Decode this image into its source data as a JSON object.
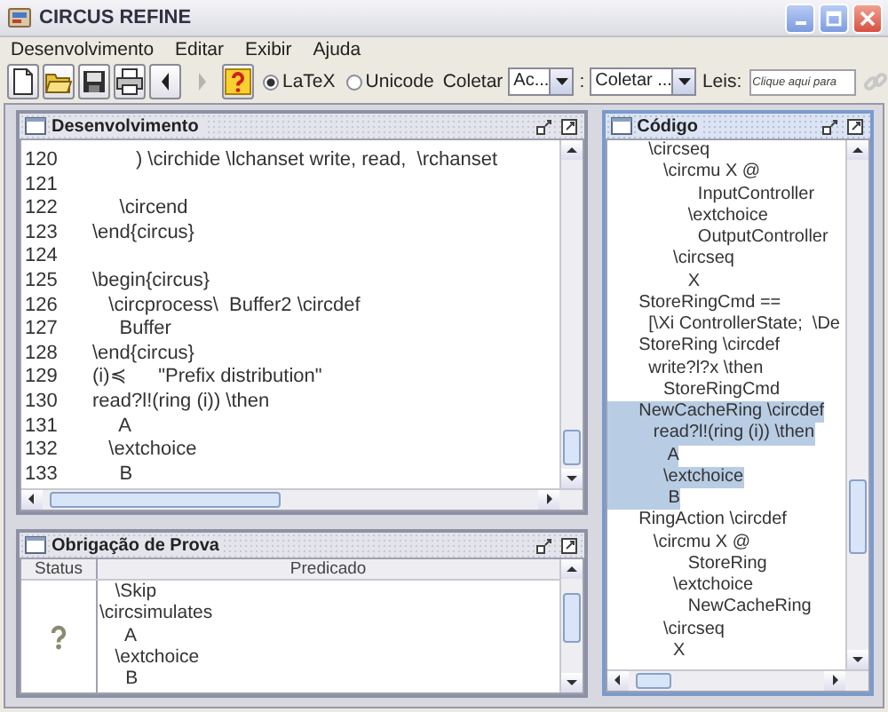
{
  "window": {
    "title": "CIRCUS REFINE"
  },
  "menu": [
    {
      "label": "Desenvolvimento"
    },
    {
      "label": "Editar"
    },
    {
      "label": "Exibir"
    },
    {
      "label": "Ajuda"
    }
  ],
  "toolbar": {
    "buttons": [
      {
        "disabled": false
      },
      {
        "disabled": false
      },
      {
        "disabled": false
      },
      {
        "disabled": false
      },
      {
        "disabled": false
      },
      {
        "disabled": true
      },
      {
        "disabled": false
      }
    ],
    "format_options": [
      {
        "label": "LaTeX",
        "selected": true
      },
      {
        "label": "Unicode",
        "selected": false
      }
    ],
    "collect_label": "Coletar",
    "collect_combo": {
      "value": "Ac..."
    },
    "separator": ":",
    "collect_combo_2": {
      "value": "Coletar ..."
    },
    "laws_label": "Leis:",
    "laws_field": {
      "placeholder": "Clique aqui para"
    },
    "link_button": {
      "disabled": true
    }
  },
  "development_panel": {
    "title": "Desenvolvimento",
    "active": false,
    "lines": [
      {
        "number": "120",
        "text": "        ) \\circhide \\lchanset write, read,  \\rchanset"
      },
      {
        "number": "121"
      },
      {
        "number": "122",
        "text": "     \\circend"
      },
      {
        "number": "123",
        "text": "\\end{circus}"
      },
      {
        "number": "124"
      },
      {
        "number": "125",
        "text": "\\begin{circus}"
      },
      {
        "number": "126",
        "text": "   \\circprocess\\  Buffer2 \\circdef"
      },
      {
        "number": "127",
        "text": "     Buffer"
      },
      {
        "number": "128",
        "text": "\\end{circus}"
      },
      {
        "number": "129",
        "text": "(i)≼      \"Prefix distribution\""
      },
      {
        "number": "130",
        "text": "read?l!(ring (i)) \\then"
      },
      {
        "number": "131",
        "text": "     A"
      },
      {
        "number": "132",
        "text": "   \\extchoice"
      },
      {
        "number": "133",
        "text": "     B"
      }
    ]
  },
  "code_panel": {
    "title": "Código",
    "active": true,
    "lines": [
      {
        "text": "  \\circseq",
        "selected": false
      },
      {
        "text": "     \\circmu X @",
        "selected": false
      },
      {
        "text": "            InputController",
        "selected": false
      },
      {
        "text": "          \\extchoice",
        "selected": false
      },
      {
        "text": "            OutputController",
        "selected": false
      },
      {
        "text": "       \\circseq",
        "selected": false
      },
      {
        "text": "          X",
        "selected": false
      },
      {
        "text": "StoreRingCmd ==",
        "selected": false
      },
      {
        "text": "  [\\Xi ControllerState;  \\De",
        "selected": false
      },
      {
        "text": "StoreRing \\circdef",
        "selected": false
      },
      {
        "text": "  write?l?x \\then",
        "selected": false
      },
      {
        "text": "     StoreRingCmd",
        "selected": false
      },
      {
        "text": "NewCacheRing \\circdef",
        "selected": true
      },
      {
        "text": "   read?l!(ring (i)) \\then",
        "selected": true
      },
      {
        "text": "      A",
        "selected": true
      },
      {
        "text": "     \\extchoice",
        "selected": true
      },
      {
        "text": "      B",
        "selected": true
      },
      {
        "text": "RingAction \\circdef",
        "selected": false
      },
      {
        "text": "   \\circmu X @",
        "selected": false
      },
      {
        "text": "          StoreRing",
        "selected": false
      },
      {
        "text": "       \\extchoice",
        "selected": false
      },
      {
        "text": "          NewCacheRing",
        "selected": false
      },
      {
        "text": "     \\circseq",
        "selected": false
      },
      {
        "text": "       X",
        "selected": false
      }
    ]
  },
  "proof_panel": {
    "title": "Obrigação de Prova",
    "active": false,
    "columns": [
      "Status",
      "Predicado"
    ],
    "rows": [
      {
        "kind": "pending",
        "predicate": "   \\Skip\n\\circsimulates\n     A\n   \\extchoice\n     B"
      }
    ]
  }
}
